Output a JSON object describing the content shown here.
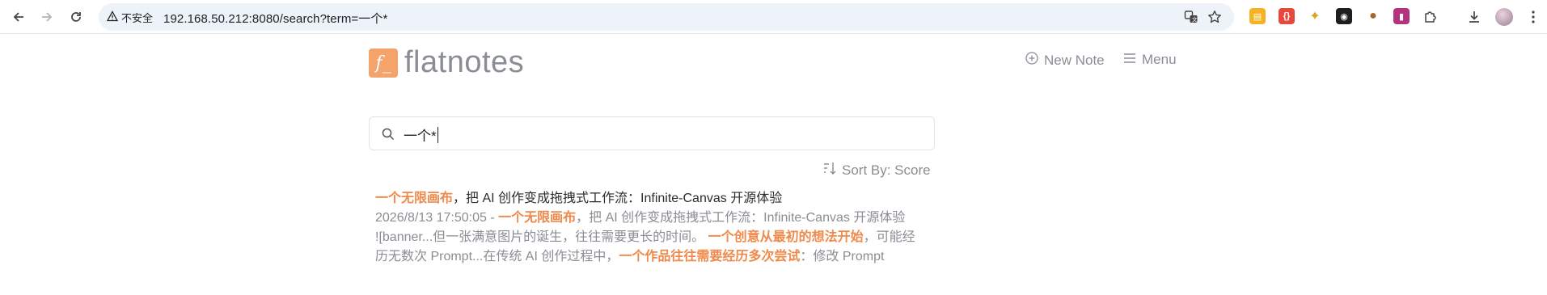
{
  "browser": {
    "security_label": "不安全",
    "url": "192.168.50.212:8080/search?term=一个*"
  },
  "app": {
    "logo_glyph": "f_",
    "name": "flatnotes",
    "new_note_label": "New Note",
    "menu_label": "Menu",
    "accent_color": "#f4a36b"
  },
  "search": {
    "value": "一个*"
  },
  "sort": {
    "label": "Sort By: Score"
  },
  "results": [
    {
      "title_highlight": "一个无限画布",
      "title_rest": "，把 AI 创作变成拖拽式工作流：Infinite-Canvas 开源体验",
      "line1_prefix": "2026/8/13 17:50:05 - ",
      "line1_highlight": "一个无限画布",
      "line1_rest": "，把 AI 创作变成拖拽式工作流：Infinite-Canvas 开源体验",
      "line2_prefix": "![banner...但一张满意图片的诞生，往往需要更长的时间。 ",
      "line2_highlight": "一个创意从最初的想法开始",
      "line2_rest": "，可能经",
      "line3_prefix": "历无数次 Prompt...在传统 AI 创作过程中，",
      "line3_highlight": "一个作品往往需要经历多次尝试",
      "line3_rest": "：修改 Prompt"
    }
  ]
}
